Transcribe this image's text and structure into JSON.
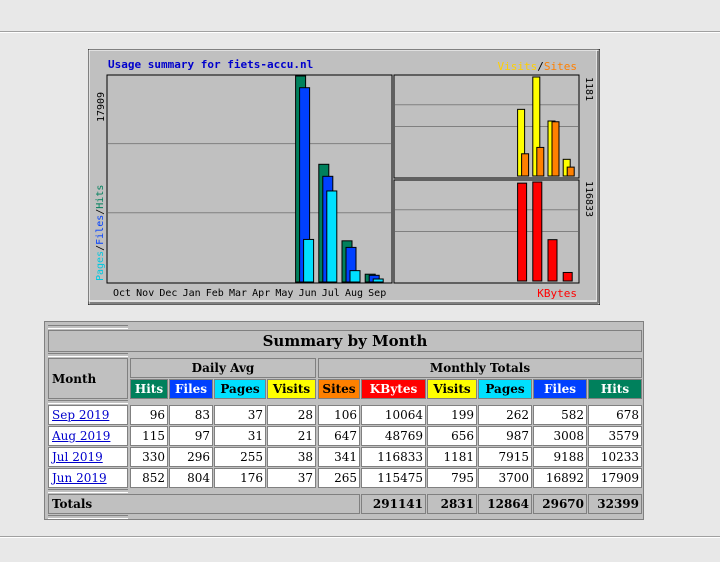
{
  "colors": {
    "hits": "#00805c",
    "files": "#0040ff",
    "pages": "#00e0ff",
    "visits": "#ffff00",
    "sites": "#ff8000",
    "kbytes": "#ff0000",
    "month_link": "#0000cc"
  },
  "chart_data": {
    "type": "bar",
    "title": "Usage summary for fiets-accu.nl",
    "categories": [
      "Oct",
      "Nov",
      "Dec",
      "Jan",
      "Feb",
      "Mar",
      "Apr",
      "May",
      "Jun",
      "Jul",
      "Aug",
      "Sep"
    ],
    "panels": {
      "main": {
        "ylabel_parts": [
          "Pages",
          "Files",
          "Hits"
        ],
        "ymax_label": "17909",
        "ylim": [
          0,
          17909
        ],
        "grid": true,
        "series": [
          {
            "name": "Hits",
            "values": [
              0,
              0,
              0,
              0,
              0,
              0,
              0,
              0,
              17909,
              10233,
              3579,
              678
            ]
          },
          {
            "name": "Files",
            "values": [
              0,
              0,
              0,
              0,
              0,
              0,
              0,
              0,
              16892,
              9188,
              3008,
              582
            ]
          },
          {
            "name": "Pages",
            "values": [
              0,
              0,
              0,
              0,
              0,
              0,
              0,
              0,
              3700,
              7915,
              987,
              262
            ]
          }
        ]
      },
      "visits": {
        "legend_parts": [
          "Visits",
          "Sites"
        ],
        "ymax_label": "1181",
        "ylim": [
          0,
          1181
        ],
        "series": [
          {
            "name": "Visits",
            "values": [
              0,
              0,
              0,
              0,
              0,
              0,
              0,
              0,
              795,
              1181,
              656,
              199
            ]
          },
          {
            "name": "Sites",
            "values": [
              0,
              0,
              0,
              0,
              0,
              0,
              0,
              0,
              265,
              341,
              647,
              106
            ]
          }
        ]
      },
      "kbytes": {
        "legend": "KBytes",
        "ymax_label": "116833",
        "ylim": [
          0,
          116833
        ],
        "series": [
          {
            "name": "KBytes",
            "values": [
              0,
              0,
              0,
              0,
              0,
              0,
              0,
              0,
              115475,
              116833,
              48769,
              10064
            ]
          }
        ]
      }
    }
  },
  "table": {
    "title": "Summary by Month",
    "month_label": "Month",
    "daily_label": "Daily Avg",
    "monthly_label": "Monthly Totals",
    "daily_headers": [
      "Hits",
      "Files",
      "Pages",
      "Visits"
    ],
    "monthly_headers": [
      "Sites",
      "KBytes",
      "Visits",
      "Pages",
      "Files",
      "Hits"
    ],
    "rows": [
      {
        "month": "Sep 2019",
        "daily": [
          "96",
          "83",
          "37",
          "28"
        ],
        "monthly": [
          "106",
          "10064",
          "199",
          "262",
          "582",
          "678"
        ]
      },
      {
        "month": "Aug 2019",
        "daily": [
          "115",
          "97",
          "31",
          "21"
        ],
        "monthly": [
          "647",
          "48769",
          "656",
          "987",
          "3008",
          "3579"
        ]
      },
      {
        "month": "Jul 2019",
        "daily": [
          "330",
          "296",
          "255",
          "38"
        ],
        "monthly": [
          "341",
          "116833",
          "1181",
          "7915",
          "9188",
          "10233"
        ]
      },
      {
        "month": "Jun 2019",
        "daily": [
          "852",
          "804",
          "176",
          "37"
        ],
        "monthly": [
          "265",
          "115475",
          "795",
          "3700",
          "16892",
          "17909"
        ]
      }
    ],
    "totals_label": "Totals",
    "totals": [
      "291141",
      "2831",
      "12864",
      "29670",
      "32399"
    ]
  }
}
